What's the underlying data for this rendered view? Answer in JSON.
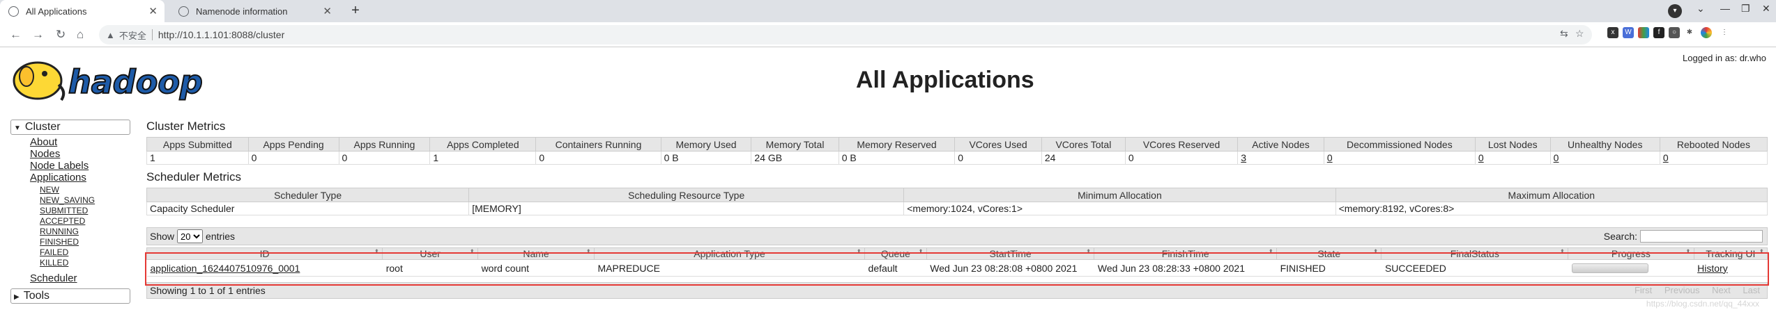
{
  "browser": {
    "tabs": [
      {
        "title": "All Applications",
        "active": true
      },
      {
        "title": "Namenode information",
        "active": false
      }
    ],
    "security_label": "不安全",
    "url": "http://10.1.1.101:8088/cluster"
  },
  "page": {
    "title": "All Applications",
    "logged_in": "Logged in as: dr.who",
    "logo_text": "hadoop"
  },
  "sidebar": {
    "cluster_label": "Cluster",
    "links": [
      "About",
      "Nodes",
      "Node Labels",
      "Applications"
    ],
    "app_states": [
      "NEW",
      "NEW_SAVING",
      "SUBMITTED",
      "ACCEPTED",
      "RUNNING",
      "FINISHED",
      "FAILED",
      "KILLED"
    ],
    "scheduler_label": "Scheduler",
    "tools_label": "Tools"
  },
  "cluster_metrics": {
    "title": "Cluster Metrics",
    "headers": [
      "Apps Submitted",
      "Apps Pending",
      "Apps Running",
      "Apps Completed",
      "Containers Running",
      "Memory Used",
      "Memory Total",
      "Memory Reserved",
      "VCores Used",
      "VCores Total",
      "VCores Reserved",
      "Active Nodes",
      "Decommissioned Nodes",
      "Lost Nodes",
      "Unhealthy Nodes",
      "Rebooted Nodes"
    ],
    "values": [
      "1",
      "0",
      "0",
      "1",
      "0",
      "0 B",
      "24 GB",
      "0 B",
      "0",
      "24",
      "0",
      "3",
      "0",
      "0",
      "0",
      "0"
    ]
  },
  "scheduler_metrics": {
    "title": "Scheduler Metrics",
    "headers": [
      "Scheduler Type",
      "Scheduling Resource Type",
      "Minimum Allocation",
      "Maximum Allocation"
    ],
    "values": [
      "Capacity Scheduler",
      "[MEMORY]",
      "<memory:1024, vCores:1>",
      "<memory:8192, vCores:8>"
    ]
  },
  "apps_table": {
    "show_label": "Show",
    "entries_value": "20",
    "entries_label": "entries",
    "search_label": "Search:",
    "headers": [
      "ID",
      "User",
      "Name",
      "Application Type",
      "Queue",
      "StartTime",
      "FinishTime",
      "State",
      "FinalStatus",
      "Progress",
      "Tracking UI"
    ],
    "rows": [
      {
        "id": "application_1624407510976_0001",
        "user": "root",
        "name": "word count",
        "type": "MAPREDUCE",
        "queue": "default",
        "start": "Wed Jun 23 08:28:08 +0800 2021",
        "finish": "Wed Jun 23 08:28:33 +0800 2021",
        "state": "FINISHED",
        "final_status": "SUCCEEDED",
        "progress": 1.0,
        "tracking": "History"
      }
    ],
    "showing": "Showing 1 to 1 of 1 entries",
    "pager": [
      "First",
      "Previous",
      "Next",
      "Last"
    ]
  },
  "watermark": "https://blog.csdn.net/qq_44xxx",
  "colors": {
    "highlight": "#e53935",
    "header_bg": "#e6e6e6"
  }
}
